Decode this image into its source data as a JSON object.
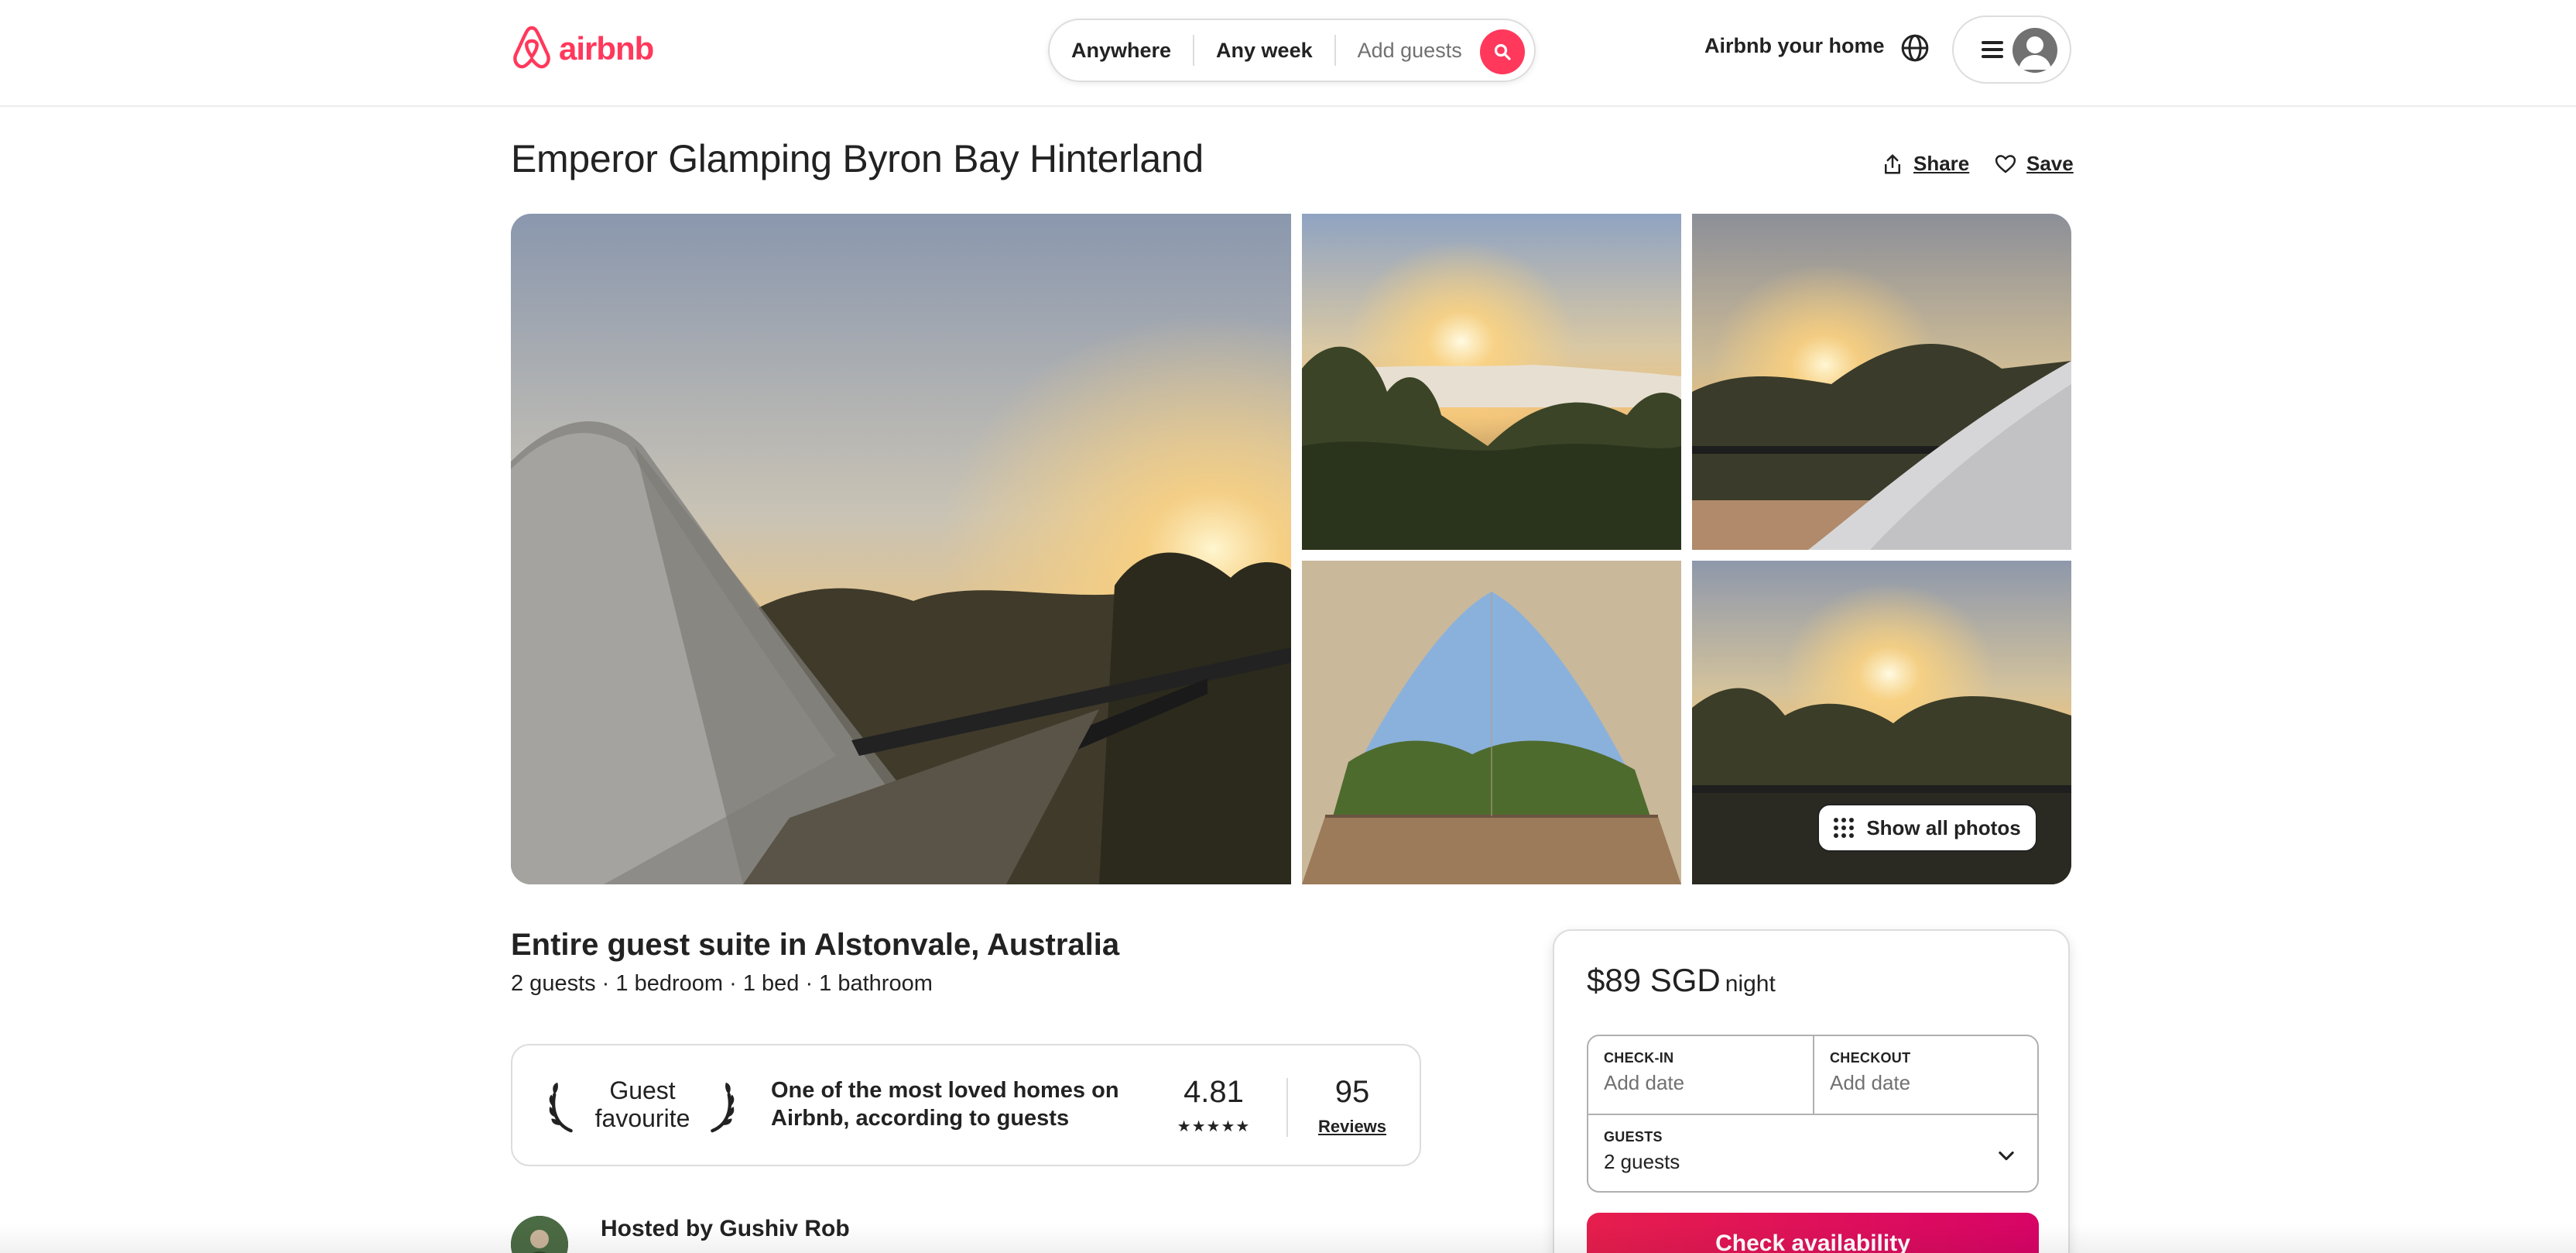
{
  "colors": {
    "brand": "#ff385c",
    "text": "#222222",
    "muted": "#717171",
    "border": "#dddddd"
  },
  "header": {
    "logo_text": "airbnb",
    "search": {
      "location": "Anywhere",
      "dates": "Any week",
      "guests_placeholder": "Add guests"
    },
    "host_link": "Airbnb your home"
  },
  "listing": {
    "title": "Emperor Glamping Byron Bay Hinterland",
    "share_label": "Share",
    "save_label": "Save",
    "show_all_photos": "Show all photos",
    "subtitle": "Entire guest suite in Alstonvale, Australia",
    "facts": "2 guests · 1 bedroom · 1 bed · 1 bathroom",
    "guest_favourite": {
      "label_line1": "Guest",
      "label_line2": "favourite",
      "description": "One of the most loved homes on Airbnb, according to guests",
      "rating": "4.81",
      "stars": "★★★★★",
      "reviews_count": "95",
      "reviews_label": "Reviews"
    },
    "host": {
      "hosted_by": "Hosted by Gushiv Rob"
    }
  },
  "booking": {
    "price": "$89 SGD",
    "price_unit": "night",
    "checkin_label": "CHECK-IN",
    "checkin_value": "Add date",
    "checkout_label": "CHECKOUT",
    "checkout_value": "Add date",
    "guests_label": "GUESTS",
    "guests_value": "2 guests",
    "cta": "Check availability"
  },
  "icons": [
    "airbnb-logo-icon",
    "search-icon",
    "globe-icon",
    "menu-icon",
    "avatar-icon",
    "share-icon",
    "heart-icon",
    "grid-dots-icon",
    "laurel-left-icon",
    "laurel-right-icon",
    "chevron-down-icon"
  ]
}
